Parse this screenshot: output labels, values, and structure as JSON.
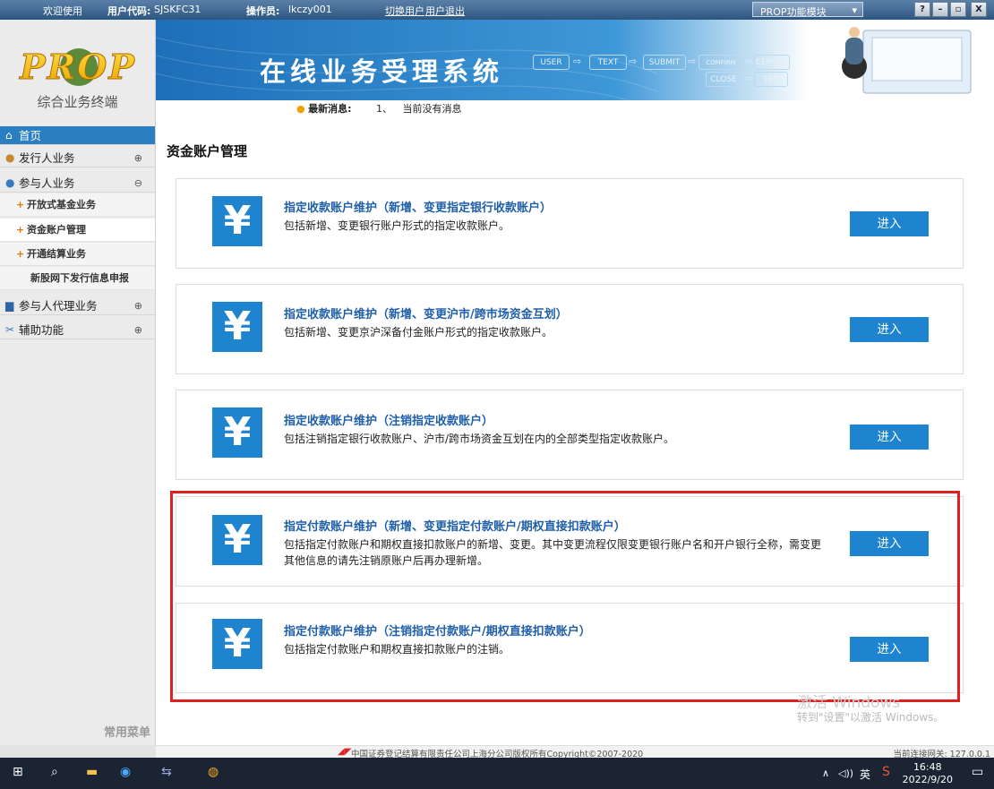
{
  "topbar": {
    "welcome": "欢迎使用",
    "user_code_label": "用户代码:",
    "user_code": "SJSKFC31",
    "operator_label": "操作员:",
    "operator": "lkczy001",
    "switch_user": "切换用户",
    "logout": "用户退出",
    "module_select": "PROP功能模块",
    "window_buttons": [
      "?",
      "–",
      "▫",
      "X"
    ]
  },
  "sidebar": {
    "logo_text": "PROP",
    "logo_subtitle": "综合业务终端",
    "home": "首页",
    "items": [
      {
        "label": "发行人业务",
        "toggle": "⊕",
        "icon": "person-icon"
      },
      {
        "label": "参与人业务",
        "toggle": "⊖",
        "icon": "people-icon"
      }
    ],
    "sub_items": [
      "开放式基金业务",
      "资金账户管理",
      "开通结算业务",
      "新股网下发行信息申报"
    ],
    "items_after": [
      {
        "label": "参与人代理业务",
        "toggle": "⊕",
        "icon": "monitor-icon"
      },
      {
        "label": "辅助功能",
        "toggle": "⊕",
        "icon": "tools-icon"
      }
    ],
    "common_menu": "常用菜单"
  },
  "banner": {
    "title": "在线业务受理系统",
    "flow": [
      "USER",
      "TEXT",
      "SUBMIT",
      "COMFIRM",
      "CERTIFY",
      "CLOSE",
      "YES"
    ]
  },
  "news": {
    "label": "最新消息:",
    "index": "1、",
    "text": "当前没有消息"
  },
  "page_title": "资金账户管理",
  "cards": [
    {
      "title": "指定收款账户维护（新增、变更指定银行收款账户）",
      "desc": "包括新增、变更银行账户形式的指定收款账户。",
      "button": "进入"
    },
    {
      "title": "指定收款账户维护（新增、变更沪市/跨市场资金互划）",
      "desc": "包括新增、变更京沪深备付金账户形式的指定收款账户。",
      "button": "进入"
    },
    {
      "title": "指定收款账户维护（注销指定收款账户）",
      "desc": "包括注销指定银行收款账户、沪市/跨市场资金互划在内的全部类型指定收款账户。",
      "button": "进入"
    },
    {
      "title": "指定付款账户维护（新增、变更指定付款账户/期权直接扣款账户）",
      "desc": "包括指定付款账户和期权直接扣款账户的新增、变更。其中变更流程仅限变更银行账户名和开户银行全称，需变更其他信息的请先注销原账户后再办理新增。",
      "button": "进入"
    },
    {
      "title": "指定付款账户维护（注销指定付款账户/期权直接扣款账户）",
      "desc": "包括指定付款账户和期权直接扣款账户的注销。",
      "button": "进入"
    }
  ],
  "watermark": {
    "line1": "激活 Windows",
    "line2": "转到\"设置\"以激活 Windows。"
  },
  "footer": {
    "copyright": "中国证券登记结算有限责任公司上海分公司版权所有Copyright©2007-2020",
    "gateway": "当前连接网关: 127.0.0.1"
  },
  "taskbar": {
    "time": "16:48",
    "date": "2022/9/20",
    "ime": "英",
    "volume": "◁))"
  }
}
